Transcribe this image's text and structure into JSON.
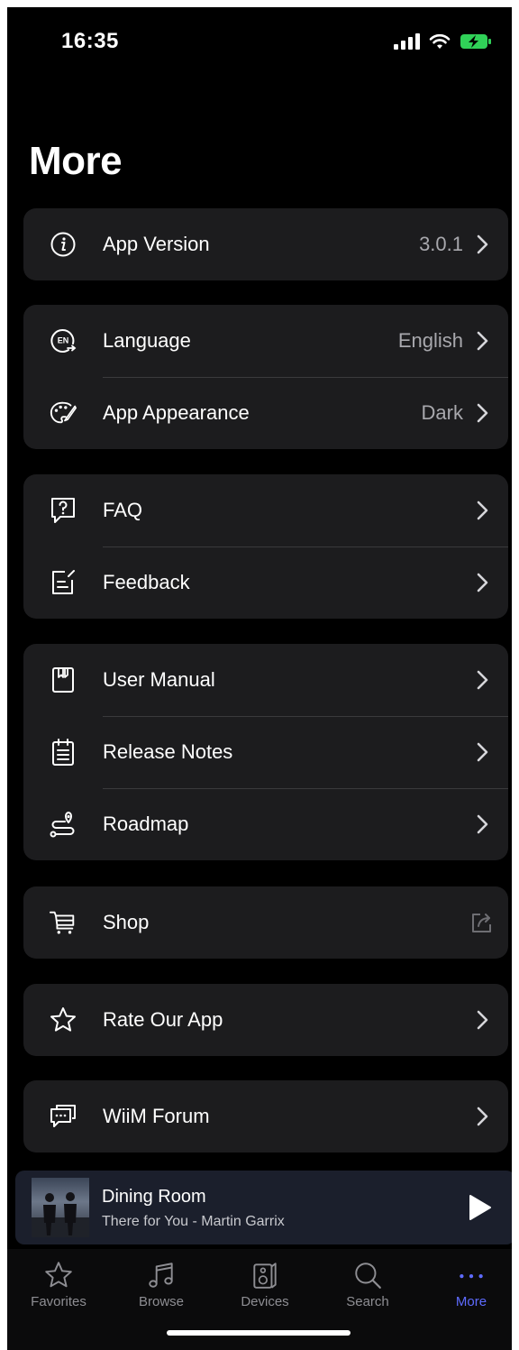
{
  "status": {
    "time": "16:35"
  },
  "page": {
    "title": "More"
  },
  "groups": {
    "version": {
      "label": "App Version",
      "value": "3.0.1"
    },
    "language": {
      "label": "Language",
      "value": "English"
    },
    "appearance": {
      "label": "App Appearance",
      "value": "Dark"
    },
    "faq": {
      "label": "FAQ"
    },
    "feedback": {
      "label": "Feedback"
    },
    "user_manual": {
      "label": "User Manual"
    },
    "release_notes": {
      "label": "Release Notes"
    },
    "roadmap": {
      "label": "Roadmap"
    },
    "shop": {
      "label": "Shop"
    },
    "rate": {
      "label": "Rate Our App"
    },
    "forum": {
      "label": "WiiM Forum"
    }
  },
  "icons": {
    "language_badge": "EN"
  },
  "now_playing": {
    "room": "Dining Room",
    "track": "There for You - Martin Garrix"
  },
  "tabs": [
    {
      "label": "Favorites",
      "icon": "star-icon"
    },
    {
      "label": "Browse",
      "icon": "music-note-icon"
    },
    {
      "label": "Devices",
      "icon": "speaker-icon"
    },
    {
      "label": "Search",
      "icon": "search-icon"
    },
    {
      "label": "More",
      "icon": "ellipsis-icon"
    }
  ],
  "colors": {
    "background": "#000000",
    "card": "#1c1c1e",
    "accent": "#5e6bff",
    "battery": "#30d158",
    "secondary_text": "#a8a8ad"
  }
}
